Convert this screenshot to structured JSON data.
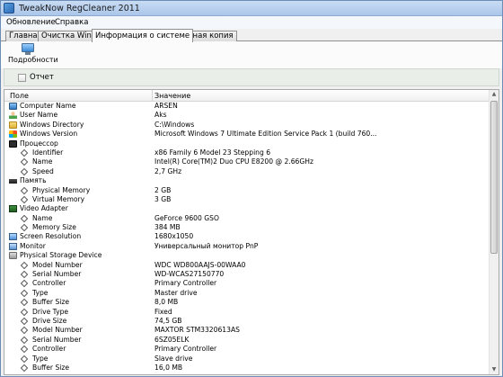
{
  "window": {
    "title": "TweakNow RegCleaner 2011",
    "icon": "app-icon"
  },
  "menu": [
    {
      "label": "Обновление"
    },
    {
      "label": "Справка"
    }
  ],
  "tabs": [
    {
      "label": "Главная",
      "active": false
    },
    {
      "label": "Очистка Windows",
      "active": false
    },
    {
      "label": "Информация о системе",
      "active": true
    },
    {
      "label": "Резервная копия",
      "active": false
    }
  ],
  "toolbar": {
    "details_label": "Подробности",
    "details_icon": "computer-icon"
  },
  "report": {
    "label": "Отчет",
    "checked": false
  },
  "grid": {
    "columns": {
      "field": "Поле",
      "value": "Значение"
    },
    "rows": [
      {
        "level": 0,
        "icon": "computer-icon",
        "field": "Computer Name",
        "value": "ARSEN"
      },
      {
        "level": 0,
        "icon": "user-icon",
        "field": "User Name",
        "value": "Aks"
      },
      {
        "level": 0,
        "icon": "folder-icon",
        "field": "Windows Directory",
        "value": "C:\\Windows"
      },
      {
        "level": 0,
        "icon": "windows-icon",
        "field": "Windows Version",
        "value": "Microsoft Windows 7 Ultimate Edition Service Pack 1 (build 760..."
      },
      {
        "level": 0,
        "icon": "cpu-icon",
        "field": "Процессор",
        "value": ""
      },
      {
        "level": 1,
        "icon": "diamond-icon",
        "field": "Identifier",
        "value": "x86 Family 6 Model 23 Stepping 6"
      },
      {
        "level": 1,
        "icon": "diamond-icon",
        "field": "Name",
        "value": "Intel(R) Core(TM)2 Duo CPU     E8200  @ 2.66GHz"
      },
      {
        "level": 1,
        "icon": "diamond-icon",
        "field": "Speed",
        "value": "2,7 GHz"
      },
      {
        "level": 0,
        "icon": "memory-icon",
        "field": "Память",
        "value": ""
      },
      {
        "level": 1,
        "icon": "diamond-icon",
        "field": "Physical Memory",
        "value": "2 GB"
      },
      {
        "level": 1,
        "icon": "diamond-icon",
        "field": "Virtual Memory",
        "value": "3 GB"
      },
      {
        "level": 0,
        "icon": "gpu-icon",
        "field": "Video Adapter",
        "value": ""
      },
      {
        "level": 1,
        "icon": "diamond-icon",
        "field": "Name",
        "value": "GeForce 9600 GSO"
      },
      {
        "level": 1,
        "icon": "diamond-icon",
        "field": "Memory Size",
        "value": "384 MB"
      },
      {
        "level": 0,
        "icon": "screen-icon",
        "field": "Screen Resolution",
        "value": "1680x1050"
      },
      {
        "level": 0,
        "icon": "monitor-icon",
        "field": "Monitor",
        "value": "Универсальный монитор PnP"
      },
      {
        "level": 0,
        "icon": "disk-icon",
        "field": "Physical Storage Device",
        "value": ""
      },
      {
        "level": 1,
        "icon": "diamond-icon",
        "field": "Model Number",
        "value": "WDC WD800AAJS-00WAA0"
      },
      {
        "level": 1,
        "icon": "diamond-icon",
        "field": "Serial Number",
        "value": "WD-WCAS27150770"
      },
      {
        "level": 1,
        "icon": "diamond-icon",
        "field": "Controller",
        "value": "Primary Controller"
      },
      {
        "level": 1,
        "icon": "diamond-icon",
        "field": "Type",
        "value": "Master drive"
      },
      {
        "level": 1,
        "icon": "diamond-icon",
        "field": "Buffer Size",
        "value": "8,0 MB"
      },
      {
        "level": 1,
        "icon": "diamond-icon",
        "field": "Drive Type",
        "value": "Fixed"
      },
      {
        "level": 1,
        "icon": "diamond-icon",
        "field": "Drive Size",
        "value": "74,5 GB"
      },
      {
        "level": 1,
        "icon": "diamond-icon",
        "field": "Model Number",
        "value": "MAXTOR STM3320613AS"
      },
      {
        "level": 1,
        "icon": "diamond-icon",
        "field": "Serial Number",
        "value": "6SZ05ELK"
      },
      {
        "level": 1,
        "icon": "diamond-icon",
        "field": "Controller",
        "value": "Primary Controller"
      },
      {
        "level": 1,
        "icon": "diamond-icon",
        "field": "Type",
        "value": "Slave drive"
      },
      {
        "level": 1,
        "icon": "diamond-icon",
        "field": "Buffer Size",
        "value": "16,0 MB"
      }
    ]
  }
}
